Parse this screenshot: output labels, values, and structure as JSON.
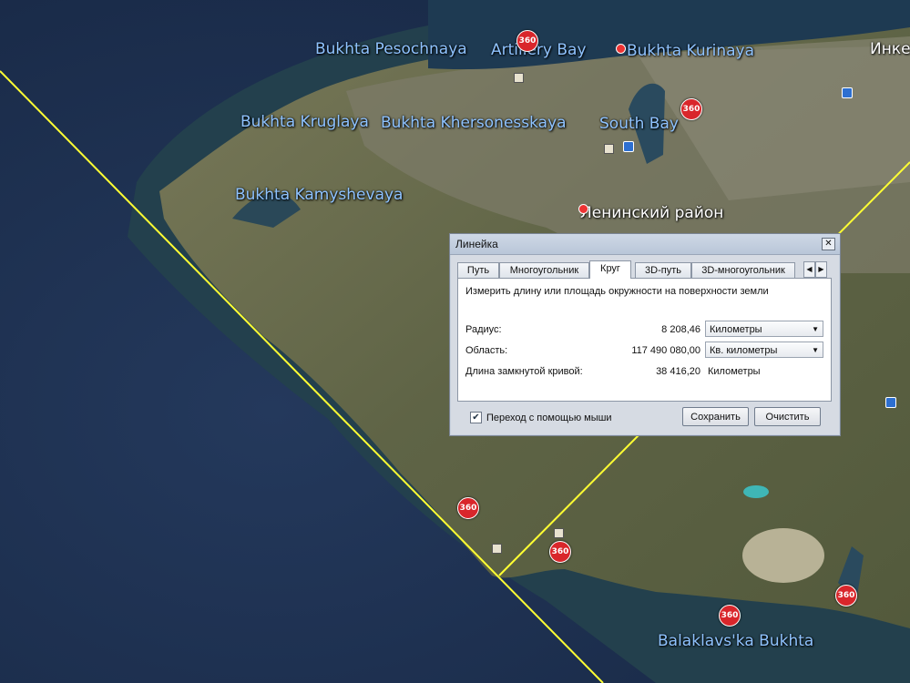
{
  "map": {
    "labels": [
      {
        "text": "Bukhta Pesochnaya",
        "style": "blue"
      },
      {
        "text": "Artillery Bay",
        "style": "blue"
      },
      {
        "text": "Bukhta Kurinaya",
        "style": "blue"
      },
      {
        "text": "Инке",
        "style": "white"
      },
      {
        "text": "Bukhta Kruglaya",
        "style": "blue"
      },
      {
        "text": "Bukhta Khersonesskaya",
        "style": "blue"
      },
      {
        "text": "South Bay",
        "style": "blue"
      },
      {
        "text": "Bukhta Kamyshevaya",
        "style": "blue"
      },
      {
        "text": "Ленинский район",
        "style": "white"
      },
      {
        "text": "Balaklavs'ka Bukhta",
        "style": "blue"
      }
    ],
    "panorama_badge": "360",
    "measure_line_color": "#ffff33",
    "sea_color": "#1d3050",
    "land_color": "#6b6b4a"
  },
  "dialog": {
    "title": "Линейка",
    "close_icon": "close-icon",
    "tabs": [
      "Путь",
      "Многоугольник",
      "Круг",
      "3D-путь",
      "3D-многоугольник"
    ],
    "active_tab": "Круг",
    "description": "Измерить длину или площадь окружности на поверхности земли",
    "radius": {
      "label": "Радиус:",
      "value": "8 208,46",
      "unit": "Километры"
    },
    "area": {
      "label": "Область:",
      "value": "117 490 080,00",
      "unit": "Кв. километры"
    },
    "circumference": {
      "label": "Длина замкнутой кривой:",
      "value": "38 416,20",
      "unit": "Километры"
    },
    "mouse_nav": {
      "label": "Переход с помощью мыши",
      "checked": true
    },
    "save_label": "Сохранить",
    "clear_label": "Очистить"
  }
}
